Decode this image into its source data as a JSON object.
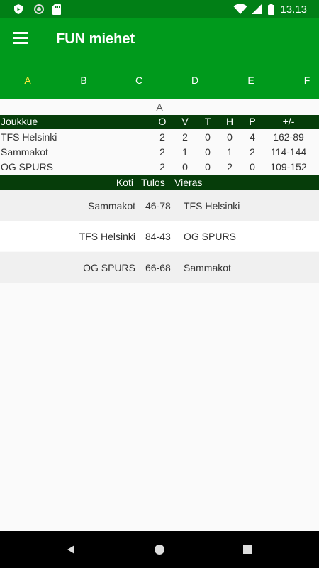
{
  "status_bar": {
    "time": "13.13",
    "icons": [
      "shield-icon",
      "circle-icon",
      "sd-card-icon",
      "wifi-icon",
      "signal-icon",
      "battery-icon"
    ]
  },
  "app_bar": {
    "title": "FUN miehet",
    "menu_icon": "hamburger-menu-icon",
    "background": "#009a1c",
    "status_background": "#017f16"
  },
  "tabs": [
    {
      "label": "A",
      "active": true
    },
    {
      "label": "B",
      "active": false
    },
    {
      "label": "C",
      "active": false
    },
    {
      "label": "D",
      "active": false
    },
    {
      "label": "E",
      "active": false
    },
    {
      "label": "F",
      "active": false
    }
  ],
  "active_tab_color": "#ffeb3b",
  "standings": {
    "group": "A",
    "header_background": "#063d0a",
    "columns": {
      "team": "Joukkue",
      "o": "O",
      "v": "V",
      "t": "T",
      "h": "H",
      "p": "P",
      "diff": "+/-"
    },
    "rows": [
      {
        "team": "TFS Helsinki",
        "o": "2",
        "v": "2",
        "t": "0",
        "h": "0",
        "p": "4",
        "diff": "162-89"
      },
      {
        "team": "Sammakot",
        "o": "2",
        "v": "1",
        "t": "0",
        "h": "1",
        "p": "2",
        "diff": "114-144"
      },
      {
        "team": "OG SPURS",
        "o": "2",
        "v": "0",
        "t": "0",
        "h": "2",
        "p": "0",
        "diff": "109-152"
      }
    ]
  },
  "games": {
    "columns": {
      "home": "Koti",
      "score": "Tulos",
      "away": "Vieras"
    },
    "rows": [
      {
        "home": "Sammakot",
        "score": "46-78",
        "away": "TFS Helsinki"
      },
      {
        "home": "TFS Helsinki",
        "score": "84-43",
        "away": "OG SPURS"
      },
      {
        "home": "OG SPURS",
        "score": "66-68",
        "away": "Sammakot"
      }
    ]
  },
  "nav_bar": {
    "icons": [
      "back-icon",
      "home-icon",
      "recents-icon"
    ]
  }
}
